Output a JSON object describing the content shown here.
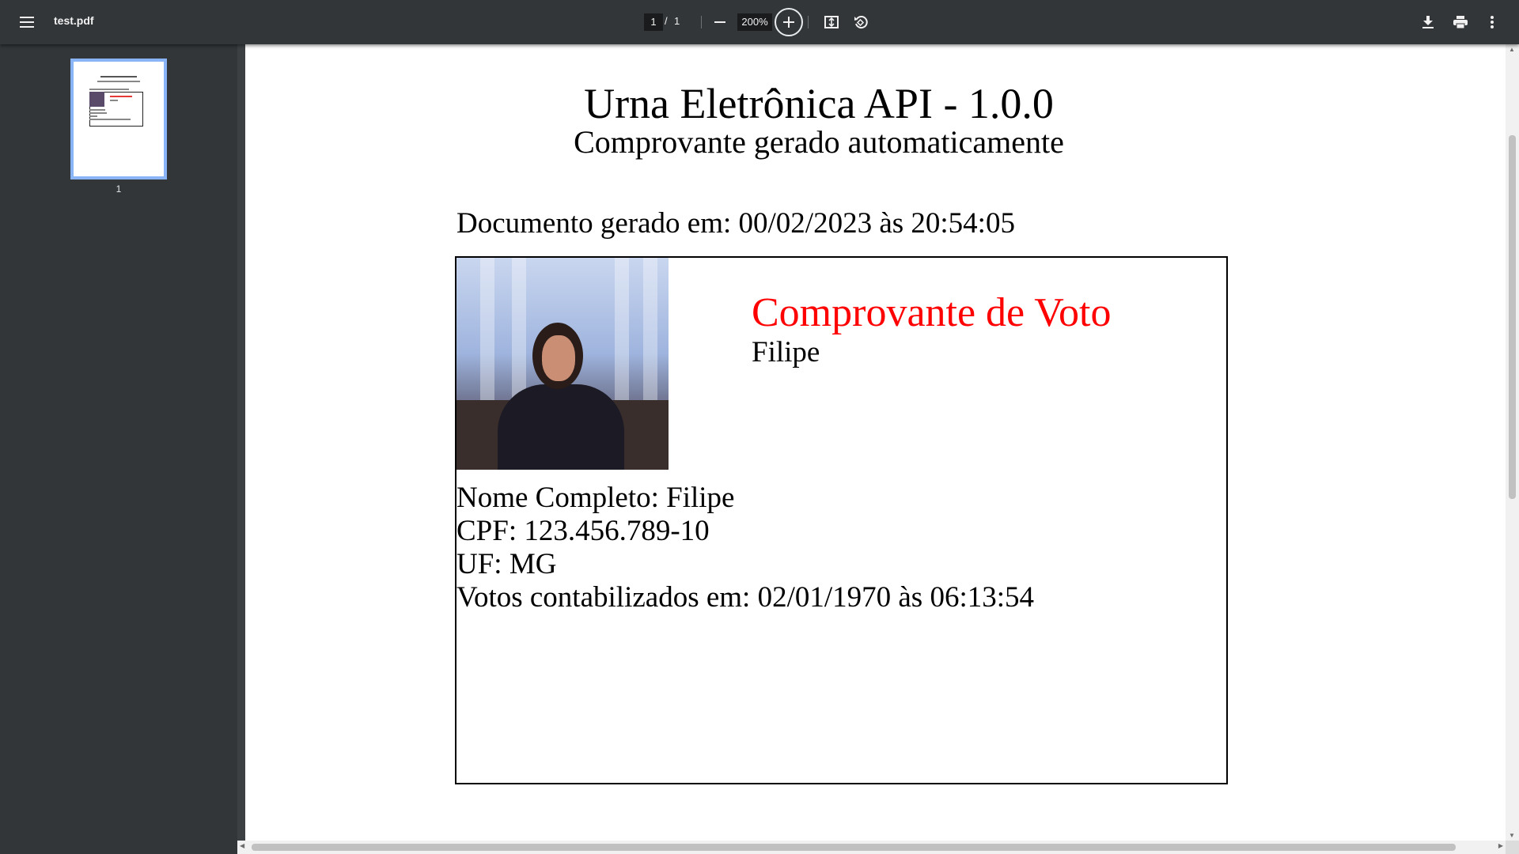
{
  "toolbar": {
    "menu_icon": "hamburger-menu-icon",
    "title": "test.pdf",
    "page_current": "1",
    "page_separator": "/",
    "page_total": "1",
    "zoom_out_icon": "minus-icon",
    "zoom_level": "200%",
    "zoom_in_icon": "plus-circle-icon",
    "fit_icon": "fit-to-page-icon",
    "rotate_icon": "rotate-counterclockwise-icon",
    "download_icon": "download-icon",
    "print_icon": "print-icon",
    "more_icon": "more-vertical-icon"
  },
  "sidebar": {
    "thumbnails": [
      {
        "page_label": "1",
        "selected": true
      }
    ],
    "selection_color": "#8ab4f8"
  },
  "document": {
    "title": "Urna Eletrônica API - 1.0.0",
    "subtitle": "Comprovante gerado automaticamente",
    "generated_line": "Documento gerado em: 00/02/2023 às 20:54:05",
    "card": {
      "heading": "Comprovante de Voto",
      "heading_color": "#ff0000",
      "name": "Filipe",
      "fields": [
        "Nome Completo: Filipe",
        "CPF: 123.456.789-10",
        "UF: MG",
        "Votos contabilizados em: 02/01/1970 às 06:13:54"
      ]
    }
  },
  "colors": {
    "toolbar_bg": "#323639",
    "viewer_bg": "#525659",
    "page_bg": "#ffffff"
  }
}
